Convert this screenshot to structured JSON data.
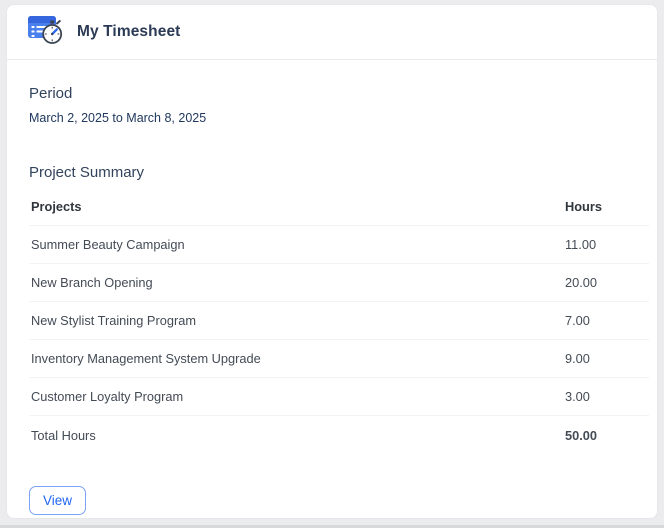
{
  "card": {
    "header": {
      "title": "My Timesheet",
      "icon": "timesheet-icon"
    },
    "period": {
      "heading": "Period",
      "range": "March 2, 2025 to March 8, 2025"
    },
    "summary": {
      "heading": "Project Summary",
      "table": {
        "columns": [
          "Projects",
          "Hours"
        ],
        "rows": [
          {
            "project": "Summer Beauty Campaign",
            "hours": "11.00"
          },
          {
            "project": "New Branch Opening",
            "hours": "20.00"
          },
          {
            "project": "New Stylist Training Program",
            "hours": "7.00"
          },
          {
            "project": "Inventory Management System Upgrade",
            "hours": "9.00"
          },
          {
            "project": "Customer Loyalty Program",
            "hours": "3.00"
          }
        ],
        "total": {
          "label": "Total Hours",
          "hours": "50.00"
        }
      }
    },
    "actions": {
      "view_label": "View"
    }
  },
  "colors": {
    "accent_blue": "#2166f3",
    "heading_navy": "#32435c",
    "icon_blue": "#4a80ee",
    "icon_header_blue": "#3566dd",
    "page_bg": "#ececee"
  }
}
